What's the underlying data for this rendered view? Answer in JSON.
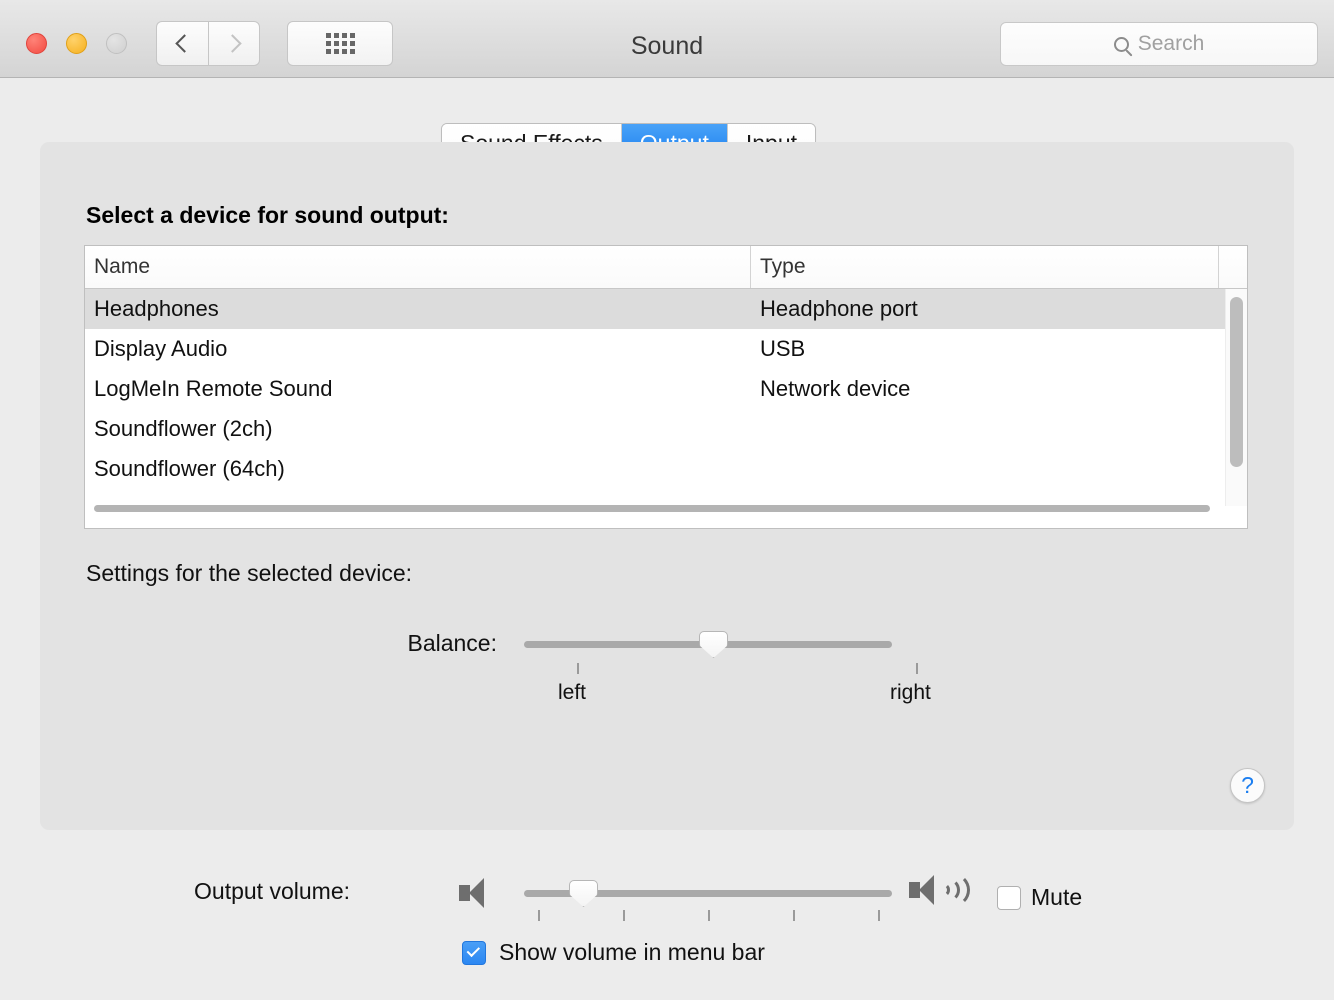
{
  "window": {
    "title": "Sound",
    "traffic_lights": [
      {
        "name": "close",
        "color": "#f24b42"
      },
      {
        "name": "minimize",
        "color": "#f5b01f"
      },
      {
        "name": "zoom",
        "color": "#cfcfcf"
      }
    ],
    "nav": {
      "back": "back-chevron",
      "forward": "forward-chevron",
      "show_all": "grid-icon"
    },
    "search": {
      "placeholder": "Search",
      "value": "",
      "icon": "search-icon"
    }
  },
  "tabs": [
    {
      "label": "Sound Effects",
      "active": false
    },
    {
      "label": "Output",
      "active": true
    },
    {
      "label": "Input",
      "active": false
    }
  ],
  "colors": {
    "accent": "#1a7ef0",
    "tab_active_top": "#49a2f7",
    "tab_active_bottom": "#1a7ef0",
    "selected_row": "#dcdcdc",
    "panel_bg": "#e3e3e3",
    "window_bg": "#ececec",
    "help_blue": "#1b7ef0"
  },
  "output_pane": {
    "section_label": "Select a device for sound output:",
    "table": {
      "columns": [
        "Name",
        "Type"
      ],
      "rows": [
        {
          "name": "Headphones",
          "type": "Headphone port",
          "selected": true
        },
        {
          "name": "Display Audio",
          "type": "USB",
          "selected": false
        },
        {
          "name": "LogMeIn Remote Sound",
          "type": "Network device",
          "selected": false
        },
        {
          "name": "Soundflower (2ch)",
          "type": "",
          "selected": false
        },
        {
          "name": "Soundflower (64ch)",
          "type": "",
          "selected": false
        }
      ]
    },
    "settings_label": "Settings for the selected device:",
    "balance": {
      "label": "Balance:",
      "min_label": "left",
      "max_label": "right",
      "value_percent": 50
    },
    "help_button": "?"
  },
  "footer": {
    "output_volume_label": "Output volume:",
    "volume_percent": 16,
    "volume_tick_count": 5,
    "speaker_min_icon": "speaker-muted-icon",
    "speaker_max_icon": "speaker-loud-icon",
    "mute": {
      "label": "Mute",
      "checked": false
    },
    "show_volume": {
      "label": "Show volume in menu bar",
      "checked": true
    }
  }
}
